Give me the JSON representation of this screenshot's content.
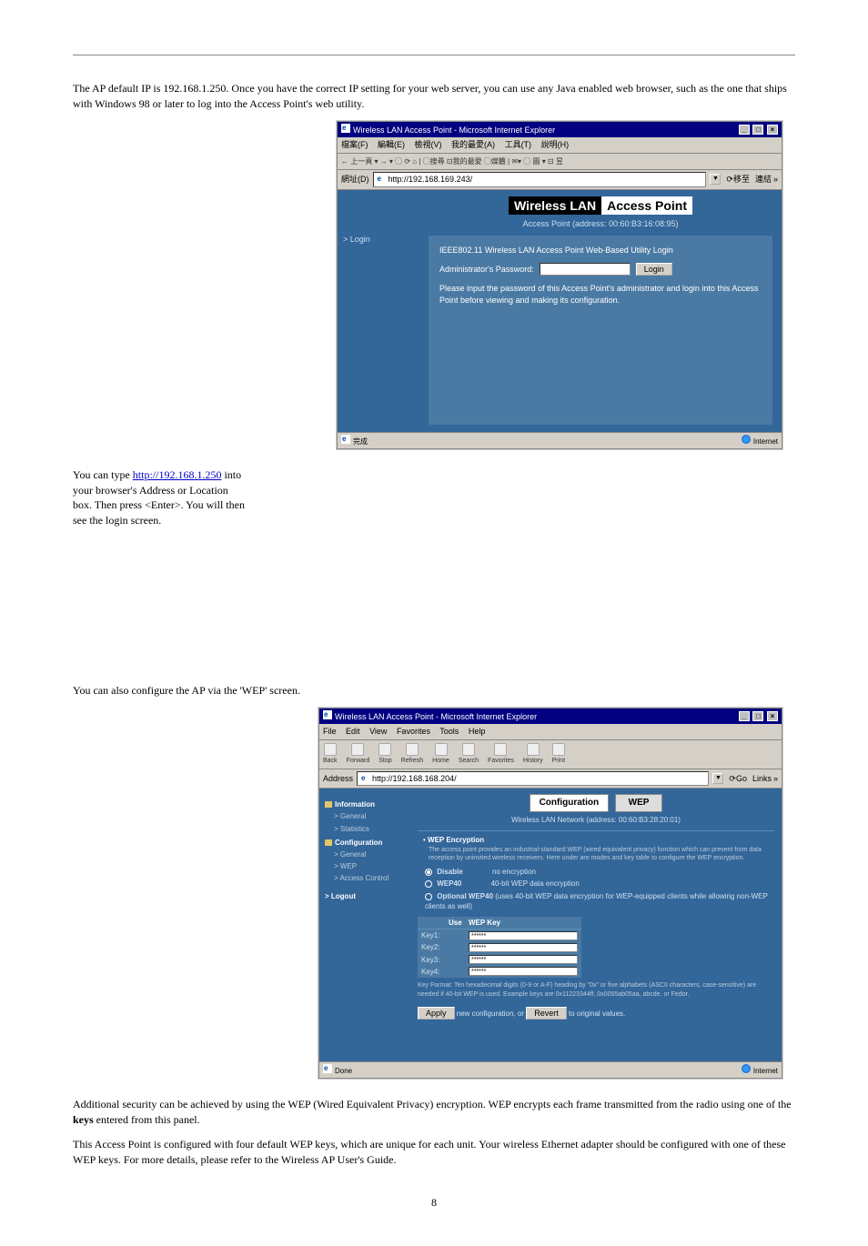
{
  "doc": {
    "intro": "The AP default IP is 192.168.1.250. Once you have the correct IP setting for your web server, you can use any Java enabled web browser, such as the one that ships with Windows 98 or later to log into the Access Point's web utility.",
    "para2_prefix": "You can type ",
    "link": "http://192.168.1.250",
    "para2_suffix": " into your browser's Address or Location box. Then press <Enter>. You will then see the login screen.",
    "para3": "You can also configure the AP via the 'WEP' screen.",
    "para4_prefix": "Additional security can be achieved by using the WEP (Wired Equivalent Privacy) encryption. WEP encrypts each frame transmitted from the radio using one of the ",
    "para4_bold": "keys",
    "para4_suffix": " entered from this panel.",
    "para5": "This Access Point is configured with four default WEP keys, which are unique for each unit. Your wireless Ethernet adapter should be configured with one of these WEP keys. For more details, please refer to the Wireless AP User's Guide."
  },
  "ss1": {
    "title": "Wireless LAN Access Point - Microsoft Internet Explorer",
    "menu": [
      "檔案(F)",
      "編輯(E)",
      "檢視(V)",
      "我的最愛(A)",
      "工具(T)",
      "說明(H)"
    ],
    "toolbar": "← 上一頁 ▾ → ▾ ◯ ⟳ ⌂ | ◯搜尋 ⊡我的最愛 ◯媒體 | ✉▾ ◯ 圖 ▾ ⊡ 昱",
    "address_label": "網址(D)",
    "address_value": "http://192.168.169.243/",
    "go": "移至",
    "links": "連結",
    "banner_a": "Wireless LAN",
    "banner_b": "Access Point",
    "banner_sub": "Access Point (address: 00:60:B3:16:08:95)",
    "login_nav": "> Login",
    "panel_heading": "IEEE802.11 Wireless LAN Access Point Web-Based Utility Login",
    "password_label": "Administrator's Password:",
    "login_button": "Login",
    "help_text": "Please input the password of this Access Point's administrator and login into this Access Point before viewing and making its configuration.",
    "status_left": "完成",
    "status_right": "Internet"
  },
  "ss2": {
    "title": "Wireless LAN Access Point - Microsoft Internet Explorer",
    "menu": [
      "File",
      "Edit",
      "View",
      "Favorites",
      "Tools",
      "Help"
    ],
    "tb": {
      "back": "Back",
      "forward": "Forward",
      "stop": "Stop",
      "refresh": "Refresh",
      "home": "Home",
      "search": "Search",
      "favorites": "Favorites",
      "history": "History",
      "print": "Print"
    },
    "address_label": "Address",
    "address_value": "http://192.168.168.204/",
    "go": "Go",
    "links": "Links",
    "tab1": "Configuration",
    "tab2": "WEP",
    "netaddr": "Wireless LAN Network (address: 00:60:B3:28:20:01)",
    "nav": {
      "info": "Information",
      "info_general": "> General",
      "info_stats": "> Statistics",
      "config": "Configuration",
      "config_general": "> General",
      "config_wep": "> WEP",
      "config_ac": "> Access Control",
      "logout": "> Logout"
    },
    "wep": {
      "heading": "WEP Encryption",
      "desc": "The access point provides an industrial-standard WEP (wired equivalent privacy) function which can prevent from data reception by uninvited wireless receivers. Here under are modes and key table to configure the WEP encryption.",
      "disable_label": "Disable",
      "disable_desc": "no encryption",
      "wep40_label": "WEP40",
      "wep40_desc": "40-bit WEP data encryption",
      "optwep40_label": "Optional WEP40",
      "optwep40_desc": "(uses 40-bit WEP data encryption for WEP-equipped clients while allowing non-WEP clients as well)",
      "use": "Use",
      "wepkey": "WEP Key",
      "key1": "Key1:",
      "key2": "Key2:",
      "key3": "Key3:",
      "key4": "Key4:",
      "keyval": "******",
      "key_format": "Key Format: Ten hexadecimal digits (0-9 or A-F) heading by \"0x\" or five alphabets (ASCII characters, case-sensitive) are needed if 40-bit WEP is used. Example keys are 0x11223344ff, 0x0055ab05aa, abcde, or Fedor.",
      "apply_btn": "Apply",
      "apply_text": "new configuration, or",
      "revert_btn": "Revert",
      "revert_text": "to original values."
    },
    "status_left": "Done",
    "status_right": "Internet"
  },
  "page_number": "8"
}
